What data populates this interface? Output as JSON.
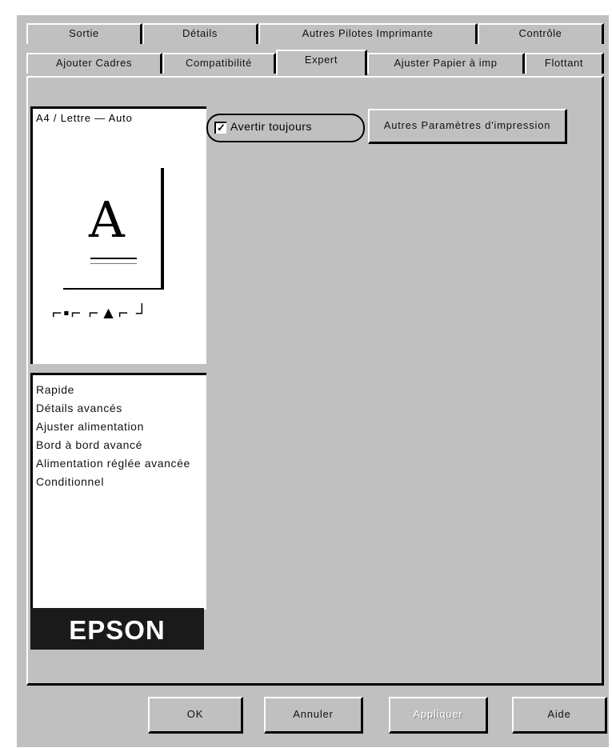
{
  "tabs": {
    "row1": [
      "Sortie",
      "Détails",
      "Autres Pilotes Imprimante",
      "Contrôle"
    ],
    "row2": [
      "Ajouter Cadres",
      "Compatibilité",
      "Expert",
      "Ajuster Papier à imp",
      "Flottant"
    ]
  },
  "preview": {
    "caption": "A4 / Lettre — Auto",
    "letter": "A",
    "icons": "⌐▪⌐ ⌐▲⌐ ┘"
  },
  "features": [
    "Rapide",
    "Détails avancés",
    "Ajuster alimentation",
    "Bord à bord avancé",
    "Alimentation réglée avancée",
    "Conditionnel"
  ],
  "brand": "EPSON",
  "options": {
    "checkbox_label": "Avertir toujours",
    "checkbox_checked": true,
    "checkmark": "✓",
    "top_button": "Autres Paramètres d'impression"
  },
  "footer": {
    "ok": "OK",
    "cancel": "Annuler",
    "apply": "Appliquer",
    "help": "Aide"
  }
}
